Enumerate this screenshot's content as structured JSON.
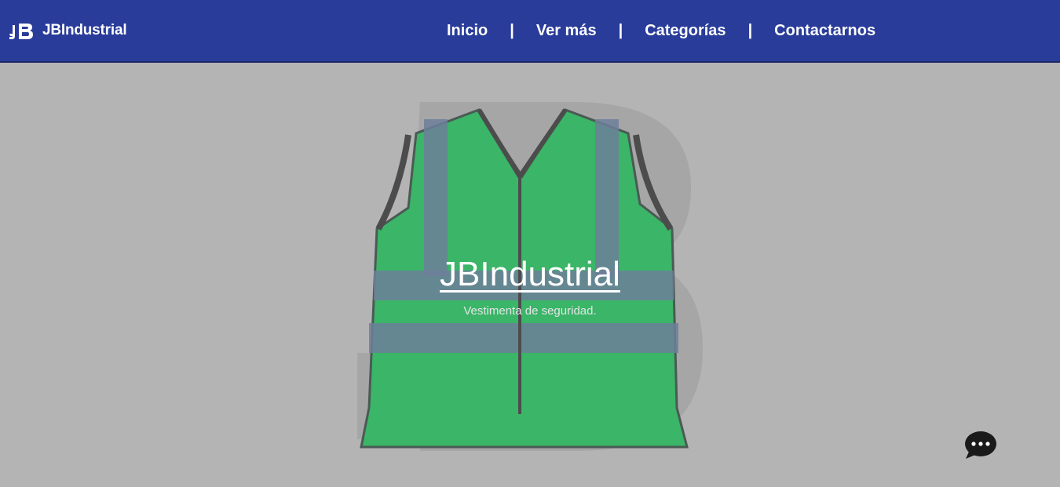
{
  "header": {
    "brand_name": "JBIndustrial",
    "logo_icon": "jb-logo-icon",
    "nav": [
      {
        "label": "Inicio"
      },
      {
        "label": "Ver más"
      },
      {
        "label": "Categorías"
      },
      {
        "label": "Contactarnos"
      }
    ],
    "separator": "|",
    "background_color": "#293c9a"
  },
  "hero": {
    "title": "JBIndustrial",
    "subtitle": "Vestimenta de seguridad.",
    "image": "safety-vest-image",
    "background_color": "#b4b4b4",
    "vest_color": "#3bb567"
  },
  "chat_widget": {
    "icon": "chat-bubble-icon"
  }
}
